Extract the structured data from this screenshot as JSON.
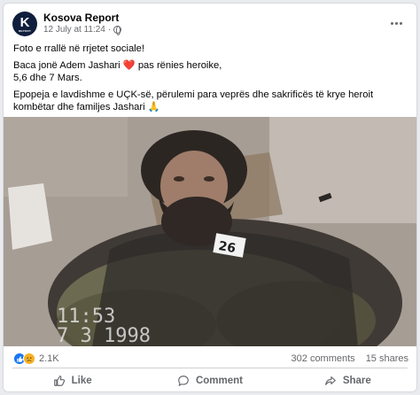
{
  "post": {
    "page_name": "Kosova Report",
    "timestamp": "12 July at 11:24",
    "visibility_icon": "globe-icon",
    "avatar": {
      "letter": "K",
      "subtext": "REPORT"
    },
    "lines": {
      "line1": "Foto e rrallë në rrjetet sociale!",
      "line2_before": "Baca jonë Adem Jashari",
      "line2_emoji": "❤️",
      "line2_after": "pas rënies heroike,",
      "line3": "5,6 dhe 7 Mars.",
      "line4": "Epopeja e lavdishme e UÇK-së, përulemi para veprës dhe sakrificës të krye heroit kombëtar dhe familjes Jashari",
      "line4_emoji": "🙏"
    },
    "photo": {
      "overlay_time": "11:53",
      "overlay_date": "7 3 1998",
      "tag_number": "26"
    }
  },
  "stats": {
    "reaction_icons": [
      "like-icon",
      "sad-icon"
    ],
    "reaction_count": "2.1K",
    "comments": "302 comments",
    "shares": "15 shares"
  },
  "actions": {
    "like": "Like",
    "comment": "Comment",
    "share": "Share"
  },
  "colors": {
    "brand_blue": "#1877f2",
    "heart_red": "#e41e3f",
    "muted_text": "#65676b"
  }
}
